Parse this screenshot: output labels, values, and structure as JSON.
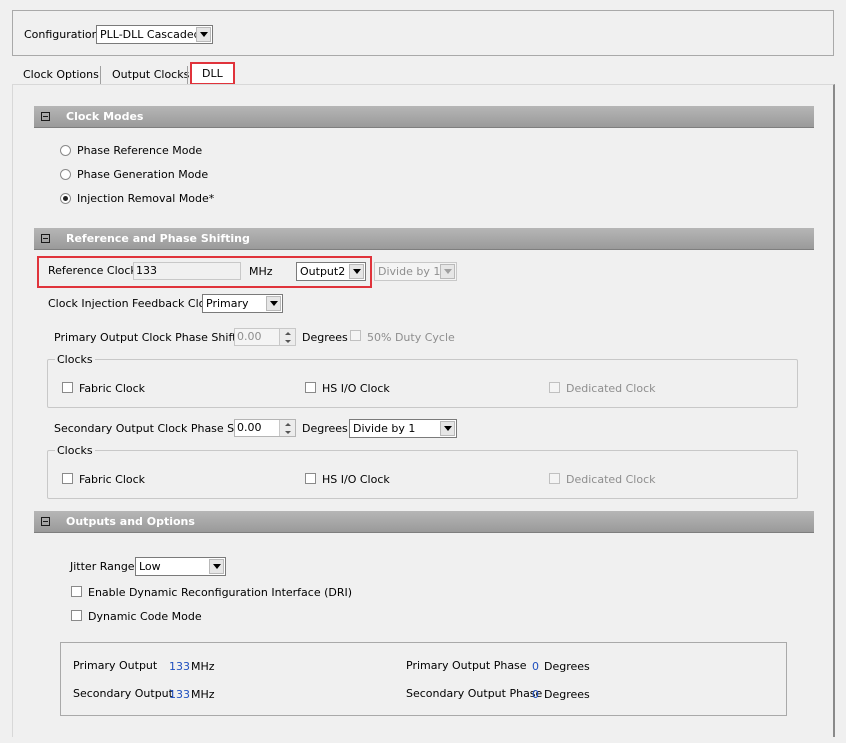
{
  "colors": {
    "highlight": "#e0333b",
    "section_header": "#a3a3a3",
    "value_blue": "#1f4fbf"
  },
  "configuration": {
    "label": "Configuration",
    "value": "PLL-DLL Cascaded"
  },
  "tabs": [
    {
      "label": "Clock Options"
    },
    {
      "label": "Output Clocks"
    },
    {
      "label": "DLL",
      "selected": true
    }
  ],
  "clock_modes": {
    "title": "Clock Modes",
    "collapse_icon": "minus-box-icon",
    "options": [
      {
        "label": "Phase Reference Mode",
        "checked": false
      },
      {
        "label": "Phase Generation Mode",
        "checked": false
      },
      {
        "label": "Injection Removal Mode*",
        "checked": true
      }
    ]
  },
  "ref_phase": {
    "title": "Reference and Phase Shifting",
    "reference_clock": {
      "label": "Reference Clock",
      "value": "133",
      "unit": "MHz",
      "source": "Output2",
      "divider": "Divide by 1"
    },
    "feedback": {
      "label": "Clock Injection Feedback Clock",
      "value": "Primary"
    },
    "primary_shift": {
      "label": "Primary Output Clock Phase Shift",
      "value": "0.00",
      "unit": "Degrees",
      "duty_cycle_label": "50% Duty Cycle"
    },
    "primary_clocks": {
      "legend": "Clocks",
      "fabric": "Fabric Clock",
      "hsio": "HS I/O Clock",
      "dedicated": "Dedicated Clock"
    },
    "secondary_shift": {
      "label": "Secondary Output Clock Phase Shift",
      "value": "0.00",
      "unit": "Degrees",
      "divider": "Divide by 1"
    },
    "secondary_clocks": {
      "legend": "Clocks",
      "fabric": "Fabric Clock",
      "hsio": "HS I/O Clock",
      "dedicated": "Dedicated Clock"
    }
  },
  "outputs": {
    "title": "Outputs and Options",
    "jitter": {
      "label": "Jitter Range",
      "value": "Low"
    },
    "dri_label": "Enable Dynamic Reconfiguration Interface (DRI)",
    "dynamic_code_label": "Dynamic Code Mode",
    "summary": {
      "primary_output_label": "Primary Output",
      "primary_output_value": "133",
      "primary_output_unit": "MHz",
      "secondary_output_label": "Secondary Output",
      "secondary_output_value": "133",
      "secondary_output_unit": "MHz",
      "primary_phase_label": "Primary Output Phase",
      "primary_phase_value": "0",
      "primary_phase_unit": "Degrees",
      "secondary_phase_label": "Secondary Output Phase",
      "secondary_phase_value": "0",
      "secondary_phase_unit": "Degrees"
    }
  }
}
